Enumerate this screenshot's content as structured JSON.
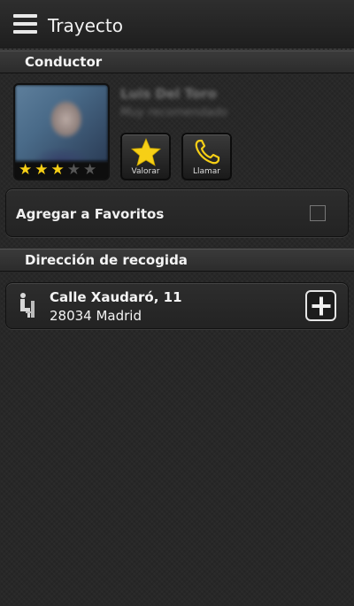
{
  "header": {
    "title": "Trayecto",
    "menu_icon": "hamburger-menu-icon"
  },
  "driver_section": {
    "title": "Conductor",
    "driver": {
      "name": "Luis Del Toro",
      "subtitle": "Muy recomendado",
      "rating": 3,
      "max_rating": 5
    },
    "actions": [
      {
        "label": "Valorar",
        "icon": "star-icon"
      },
      {
        "label": "Llamar",
        "icon": "phone-icon"
      }
    ],
    "favorites": {
      "label": "Agregar a Favoritos",
      "checked": false
    }
  },
  "pickup_section": {
    "title": "Dirección de recogida",
    "address_line1": "Calle Xaudaró, 11",
    "address_line2": "28034 Madrid",
    "icon": "seat-icon",
    "add_icon": "plus-icon"
  },
  "colors": {
    "accent_star": "#f6cf16",
    "background": "#262626",
    "text": "#ffffff"
  }
}
